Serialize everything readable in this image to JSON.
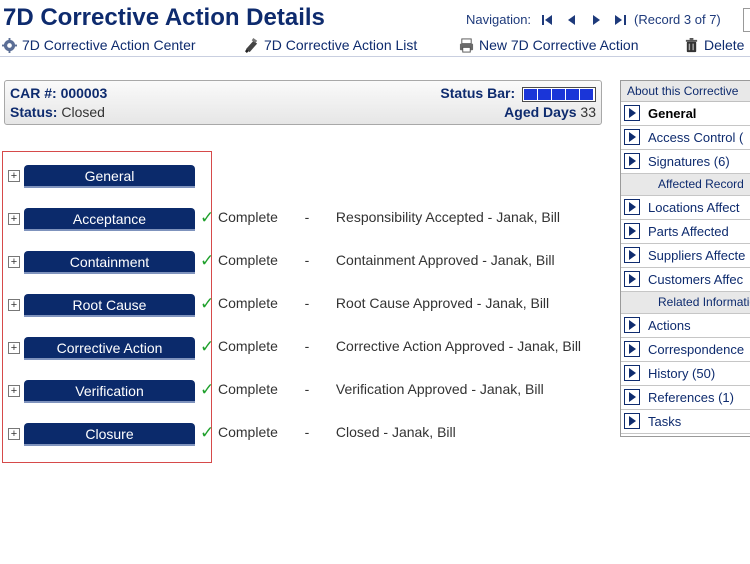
{
  "page": {
    "title": "7D Corrective Action Details"
  },
  "navigation": {
    "label": "Navigation:",
    "record_text": "(Record 3 of 7)"
  },
  "toolbar": {
    "items": [
      {
        "label": "7D Corrective Action Center",
        "icon": "gear-icon"
      },
      {
        "label": "7D Corrective Action List",
        "icon": "list-icon"
      },
      {
        "label": "New 7D Corrective Action",
        "icon": "printer-icon"
      },
      {
        "label": "Delete",
        "icon": "trash-icon"
      }
    ]
  },
  "car": {
    "number_label": "CAR #:",
    "number": "000003",
    "status_label": "Status:",
    "status": "Closed",
    "status_bar_label": "Status Bar:",
    "status_bar_segments": 5,
    "status_bar_filled": 5,
    "aged_days_label": "Aged Days",
    "aged_days": "33"
  },
  "steps": [
    {
      "name": "General",
      "complete": false,
      "status": "",
      "dash": "",
      "detail": ""
    },
    {
      "name": "Acceptance",
      "complete": true,
      "status": "Complete",
      "dash": "-",
      "detail": "Responsibility Accepted - Janak, Bill"
    },
    {
      "name": "Containment",
      "complete": true,
      "status": "Complete",
      "dash": "-",
      "detail": "Containment Approved - Janak, Bill"
    },
    {
      "name": "Root Cause",
      "complete": true,
      "status": "Complete",
      "dash": "-",
      "detail": "Root Cause Approved - Janak, Bill"
    },
    {
      "name": "Corrective Action",
      "complete": true,
      "status": "Complete",
      "dash": "-",
      "detail": "Corrective Action Approved - Janak, Bill"
    },
    {
      "name": "Verification",
      "complete": true,
      "status": "Complete",
      "dash": "-",
      "detail": "Verification Approved - Janak, Bill"
    },
    {
      "name": "Closure",
      "complete": true,
      "status": "Complete",
      "dash": "-",
      "detail": "Closed - Janak, Bill"
    }
  ],
  "sidebar": {
    "header": "About this Corrective",
    "group1": [
      {
        "label": "General",
        "active": true
      },
      {
        "label": "Access Control (",
        "active": false
      },
      {
        "label": "Signatures (6)",
        "active": false
      }
    ],
    "section_affected": "Affected Record",
    "group2": [
      {
        "label": "Locations Affect"
      },
      {
        "label": "Parts Affected"
      },
      {
        "label": "Suppliers Affecte"
      },
      {
        "label": "Customers Affec"
      }
    ],
    "section_related": "Related Informatio",
    "group3": [
      {
        "label": "Actions"
      },
      {
        "label": "Correspondence"
      },
      {
        "label": "History (50)"
      },
      {
        "label": "References (1)"
      },
      {
        "label": "Tasks"
      }
    ]
  },
  "colors": {
    "title": "#0e2b6e",
    "tab": "#0b2a6b",
    "check": "#1fa02c",
    "status_bar": "#1a35d8",
    "highlight_border": "#d64a4a"
  }
}
